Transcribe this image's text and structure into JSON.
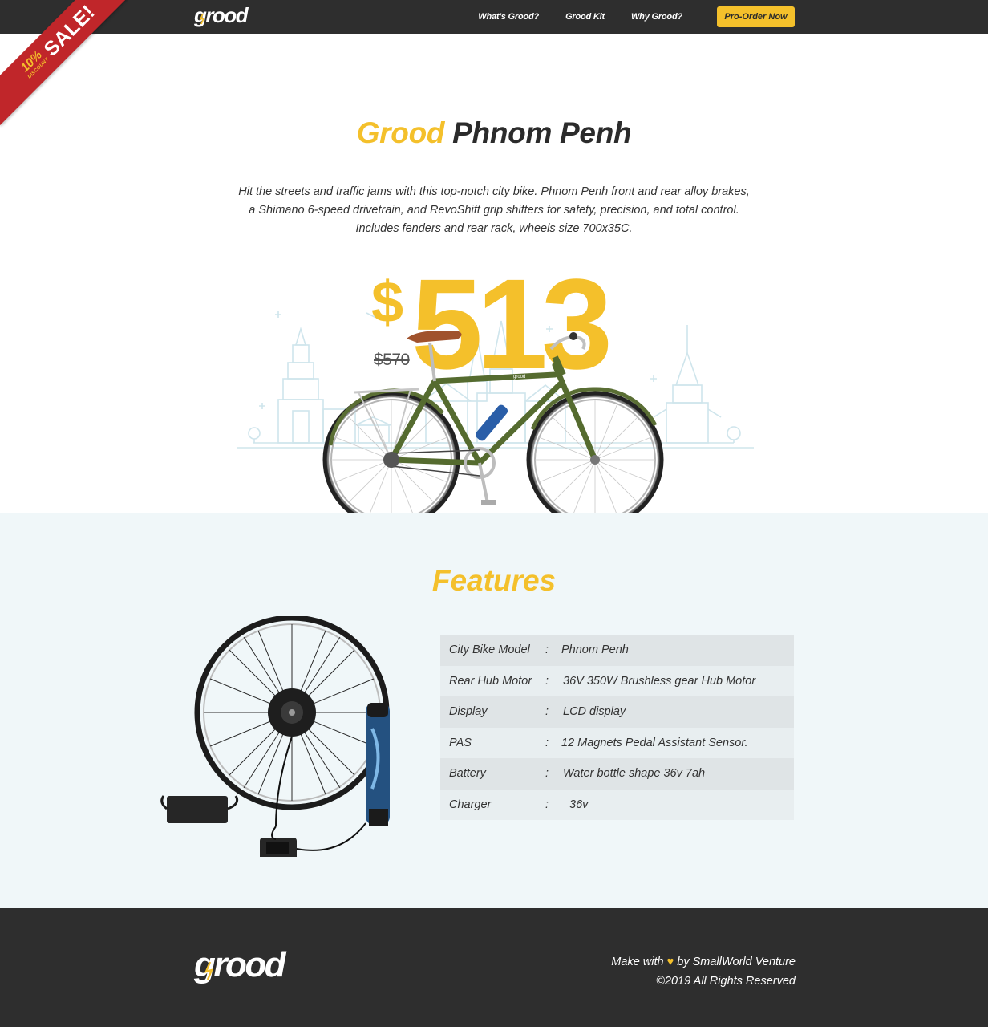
{
  "nav": {
    "logo_text": "grood",
    "links": [
      {
        "label": "What's Grood?"
      },
      {
        "label": "Grood Kit"
      },
      {
        "label": "Why Grood?"
      }
    ],
    "cta_label": "Pro-Order Now"
  },
  "ribbon": {
    "percent": "10%",
    "discount": "DISCOUNT",
    "sale": "SALE!"
  },
  "hero": {
    "brand": "Grood",
    "model": "Phnom Penh",
    "description_lines": [
      "Hit the streets and traffic jams with this top-notch city bike. Phnom Penh front and rear alloy brakes,",
      "a Shimano 6-speed drivetrain, and RevoShift grip shifters for safety, precision, and total control.",
      "Includes fenders and rear rack, wheels size 700x35C."
    ],
    "currency": "$",
    "price": "513",
    "old_price": "$570",
    "bike_frame_label": "grood"
  },
  "features": {
    "title": "Features",
    "specs": [
      {
        "label": "City Bike Model",
        "colon": ":",
        "value": "Phnom Penh"
      },
      {
        "label": "Rear Hub Motor",
        "colon": ":",
        "value": "36V 350W Brushless gear Hub Motor"
      },
      {
        "label": "Display",
        "colon": ":",
        "value": "LCD display"
      },
      {
        "label": "PAS",
        "colon": ":",
        "value": "12 Magnets Pedal Assistant Sensor."
      },
      {
        "label": "Battery",
        "colon": ":",
        "value": "Water bottle shape 36v 7ah"
      },
      {
        "label": "Charger",
        "colon": ":",
        "value": "36v"
      }
    ]
  },
  "footer": {
    "logo_text": "grood",
    "made_with": "Make with",
    "heart_icon": "heart-icon",
    "by": "by SmallWorld Venture",
    "copyright": "©2019 All Rights Reserved"
  },
  "colors": {
    "accent": "#f4c02b",
    "dark": "#2e2e2e",
    "ribbon": "#c0262a",
    "features_bg": "#f0f7f9"
  }
}
